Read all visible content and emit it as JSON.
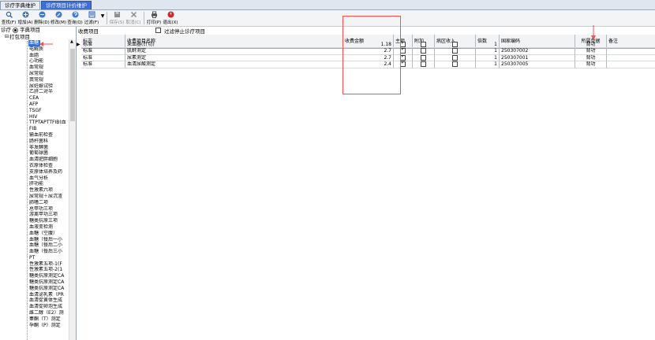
{
  "tabs": [
    "诊疗字典维护",
    "诊疗项目计价维护"
  ],
  "active_tab": 1,
  "toolbar": [
    {
      "label": "查找(F)",
      "icon": "find-icon",
      "disabled": false
    },
    {
      "label": "增加(A)",
      "icon": "add-icon",
      "disabled": false
    },
    {
      "label": "删除(D)",
      "icon": "delete-icon",
      "disabled": false
    },
    {
      "label": "修改(M)",
      "icon": "edit-icon",
      "disabled": false
    },
    {
      "label": "查询(Q)",
      "icon": "query-icon",
      "disabled": false
    },
    {
      "label": "过滤(F)",
      "icon": "filter-icon",
      "disabled": false
    },
    {
      "label": "保存(S)",
      "icon": "save-icon",
      "disabled": true
    },
    {
      "label": "取消(C)",
      "icon": "cancel-icon",
      "disabled": true
    },
    {
      "label": "打印(P)",
      "icon": "print-icon",
      "disabled": false
    },
    {
      "label": "退出(X)",
      "icon": "exit-icon",
      "disabled": false
    }
  ],
  "left": {
    "radio_a": "诊疗",
    "radio_b": "字典项目",
    "root": "打包项目",
    "items": [
      "血糖",
      "电解质",
      "血脂",
      "心功能",
      "血常规",
      "尿常规",
      "粪常规",
      "尿妊娠试验",
      "乙肝二对半",
      "CEA",
      "AFP",
      "TSGF",
      "HIV",
      "TTPTAPTTFIB(血",
      "FIB",
      "输血前检查",
      "肠杆菌科",
      "非发酵菌",
      "葡萄球菌",
      "血清肥胖细胞",
      "衣原体检查",
      "支原体培养及药",
      "血气分析",
      "肝功能",
      "性激素六项",
      "尿常规＋尿沉渣",
      "肺嗜二项",
      "总甲功三项",
      "游离甲功三项",
      "糖类抗原三项",
      "血液变检测",
      "血糖（空腹）",
      "血糖（餐后一小",
      "血糖（餐后二小",
      "血糖（餐后三小",
      "PT",
      "性激素五项-1(F",
      "性激素五项-2(1",
      "糖类抗原测定CA",
      "糖类抗原测定CA",
      "糖类抗原测定CA",
      "血清泌乳素（PR",
      "血清促黄体生成",
      "血清促卵泡生成",
      "雌二醇（E2）测",
      "睾酮（T）测定",
      "孕酮（P）测定"
    ],
    "selected": 0
  },
  "right": {
    "title": "收费项目",
    "filter_label": "过滤停止诊疗项目",
    "columns": [
      "标志",
      "收费项目名称",
      "收费金额",
      "主项",
      "附加",
      "病区收入",
      "倍数",
      "国家编码",
      "所属单据",
      "备注"
    ],
    "rows": [
      {
        "flag": "标准",
        "name": "采血器(针切)",
        "amount": "1.18",
        "main": true,
        "extra": false,
        "ward": false,
        "mult": "1",
        "code": "",
        "doc": "背功",
        "note": ""
      },
      {
        "flag": "标准",
        "name": "肌酐测定",
        "amount": "2.7",
        "main": true,
        "extra": false,
        "ward": false,
        "mult": "1",
        "code": "250307002",
        "doc": "背功",
        "note": ""
      },
      {
        "flag": "标准",
        "name": "尿素测定",
        "amount": "2.7",
        "main": true,
        "extra": false,
        "ward": false,
        "mult": "1",
        "code": "250307001",
        "doc": "背功",
        "note": ""
      },
      {
        "flag": "标准",
        "name": "血清尿酸测定",
        "amount": "2.4",
        "main": true,
        "extra": false,
        "ward": false,
        "mult": "1",
        "code": "250307005",
        "doc": "背功",
        "note": ""
      }
    ]
  },
  "colors": {
    "accent": "#3570d8",
    "annotation": "#ff4d4d",
    "tab_active": "#3d6fd6"
  }
}
